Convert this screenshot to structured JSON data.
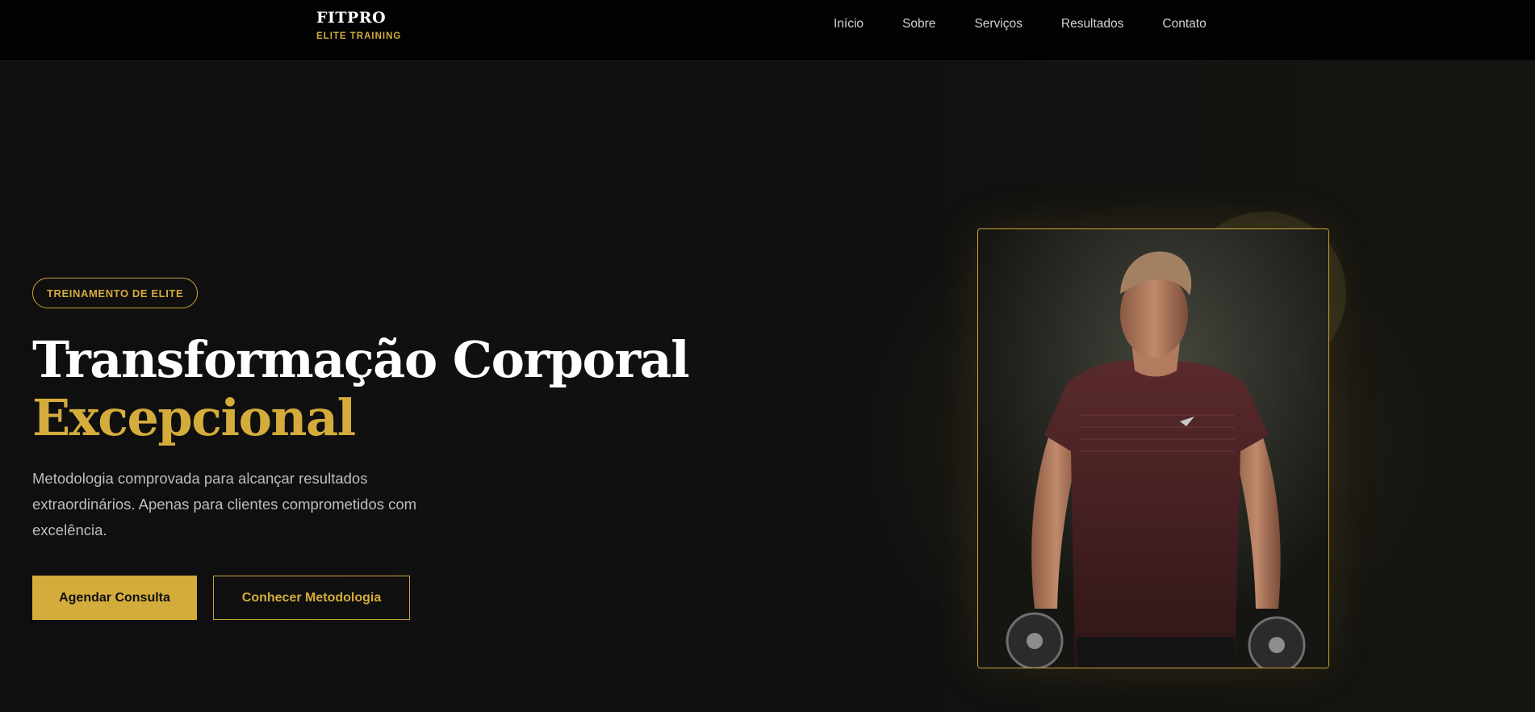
{
  "brand": {
    "name": "FITPRO",
    "tagline": "ELITE TRAINING"
  },
  "nav": {
    "links": [
      {
        "label": "Início"
      },
      {
        "label": "Sobre"
      },
      {
        "label": "Serviços"
      },
      {
        "label": "Resultados"
      },
      {
        "label": "Contato"
      }
    ]
  },
  "hero": {
    "badge": "TREINAMENTO DE ELITE",
    "title_line1": "Transformação Corporal",
    "title_line2": "Excepcional",
    "description": "Metodologia comprovada para alcançar resultados extraordinários. Apenas para clientes comprometidos com excelência.",
    "primary_button": "Agendar Consulta",
    "secondary_button": "Conhecer Metodologia"
  },
  "colors": {
    "accent": "#d4ac3c",
    "background": "#0f0f0f",
    "navbar": "#020202",
    "text_muted": "#bdbdbd"
  }
}
